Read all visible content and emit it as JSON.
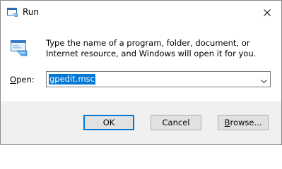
{
  "window": {
    "title": "Run",
    "close_icon": "close-icon",
    "title_icon": "run-app-icon"
  },
  "body": {
    "description": "Type the name of a program, folder, document, or Internet resource, and Windows will open it for you.",
    "icon": "run-dialog-icon"
  },
  "open": {
    "label_mnemonic": "O",
    "label_rest": "pen:",
    "value": "gpedit.msc"
  },
  "buttons": {
    "ok": "OK",
    "cancel": "Cancel",
    "browse": "Browse..."
  },
  "colors": {
    "selection": "#0078d7",
    "footer_bg": "#f0f0f0",
    "button_bg": "#e1e1e1",
    "default_button_border": "#0078d7"
  }
}
